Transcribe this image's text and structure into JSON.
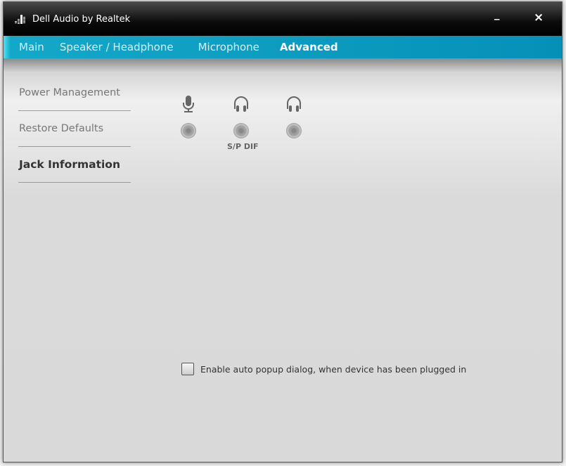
{
  "window": {
    "title": "Dell Audio by Realtek",
    "minimize": "_",
    "close": "×"
  },
  "tabs": [
    {
      "label": "Main"
    },
    {
      "label": "Speaker / Headphone"
    },
    {
      "label": "Microphone"
    },
    {
      "label": "Advanced"
    }
  ],
  "sidebar": {
    "items": [
      {
        "label": "Power Management"
      },
      {
        "label": "Restore Defaults"
      },
      {
        "label": "Jack Information"
      }
    ]
  },
  "jacks": [
    {
      "icon": "microphone-icon",
      "label": ""
    },
    {
      "icon": "headphone-icon",
      "label": "S/P DIF"
    },
    {
      "icon": "headphone-icon",
      "label": ""
    }
  ],
  "auto_popup": {
    "label": "Enable auto popup dialog, when device has been plugged in",
    "checked": false
  }
}
